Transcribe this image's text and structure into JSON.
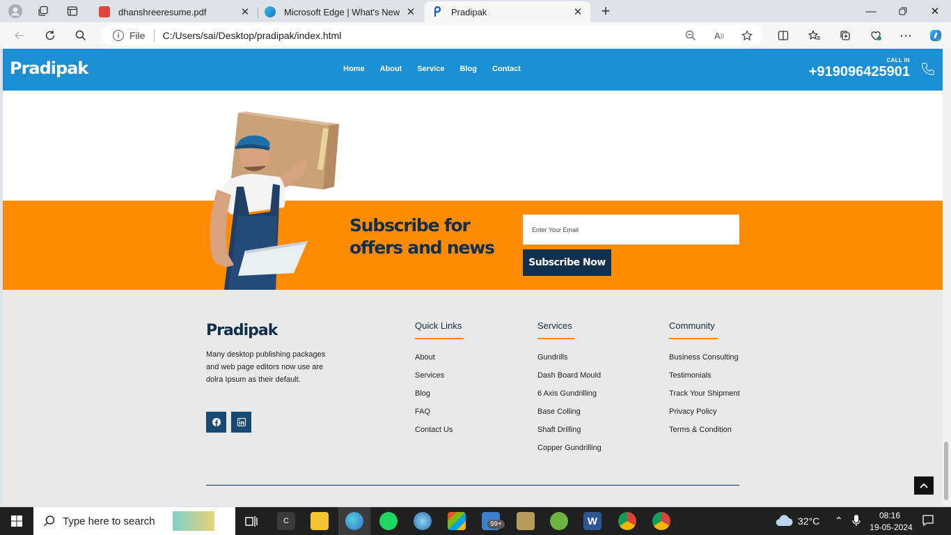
{
  "browser": {
    "tabs": [
      {
        "title": "dhanshreeresume.pdf"
      },
      {
        "title": "Microsoft Edge | What's New"
      },
      {
        "title": "Pradipak"
      }
    ],
    "address": {
      "scheme": "File",
      "url": "C:/Users/sai/Desktop/pradipak/index.html"
    }
  },
  "site": {
    "logo": "Pradipak",
    "nav": [
      "Home",
      "About",
      "Service",
      "Blog",
      "Contact"
    ],
    "call_label": "CALL IN",
    "phone": "+919096425901"
  },
  "subscribe": {
    "title": "Subscribe for offers and news",
    "email_placeholder": "Enter Your Email",
    "button": "Subscribe Now"
  },
  "footer": {
    "logo": "Pradipak",
    "description": "Many desktop publishing packages and web page editors now use are dolra Ipsum as their default.",
    "columns": [
      {
        "title": "Quick Links",
        "links": [
          "About",
          "Services",
          "Blog",
          "FAQ",
          "Contact Us"
        ]
      },
      {
        "title": "Services",
        "links": [
          "Gundrills",
          "Dash Board Mould",
          "6 Axis Gundrilling",
          "Base Colling",
          "Shaft Drilling",
          "Copper Gundrilling"
        ]
      },
      {
        "title": "Community",
        "links": [
          "Business Consulting",
          "Testimonials",
          "Track Your Shipment",
          "Privacy Policy",
          "Terms & Condition"
        ]
      }
    ]
  },
  "taskbar": {
    "search_placeholder": "Type here to search",
    "weather": "32°C",
    "time": "08:16",
    "date": "19-05-2024",
    "badge": "99+"
  },
  "colors": {
    "header": "#1c8fd4",
    "accent": "#ff8b00",
    "navy": "#0f2f4c"
  }
}
